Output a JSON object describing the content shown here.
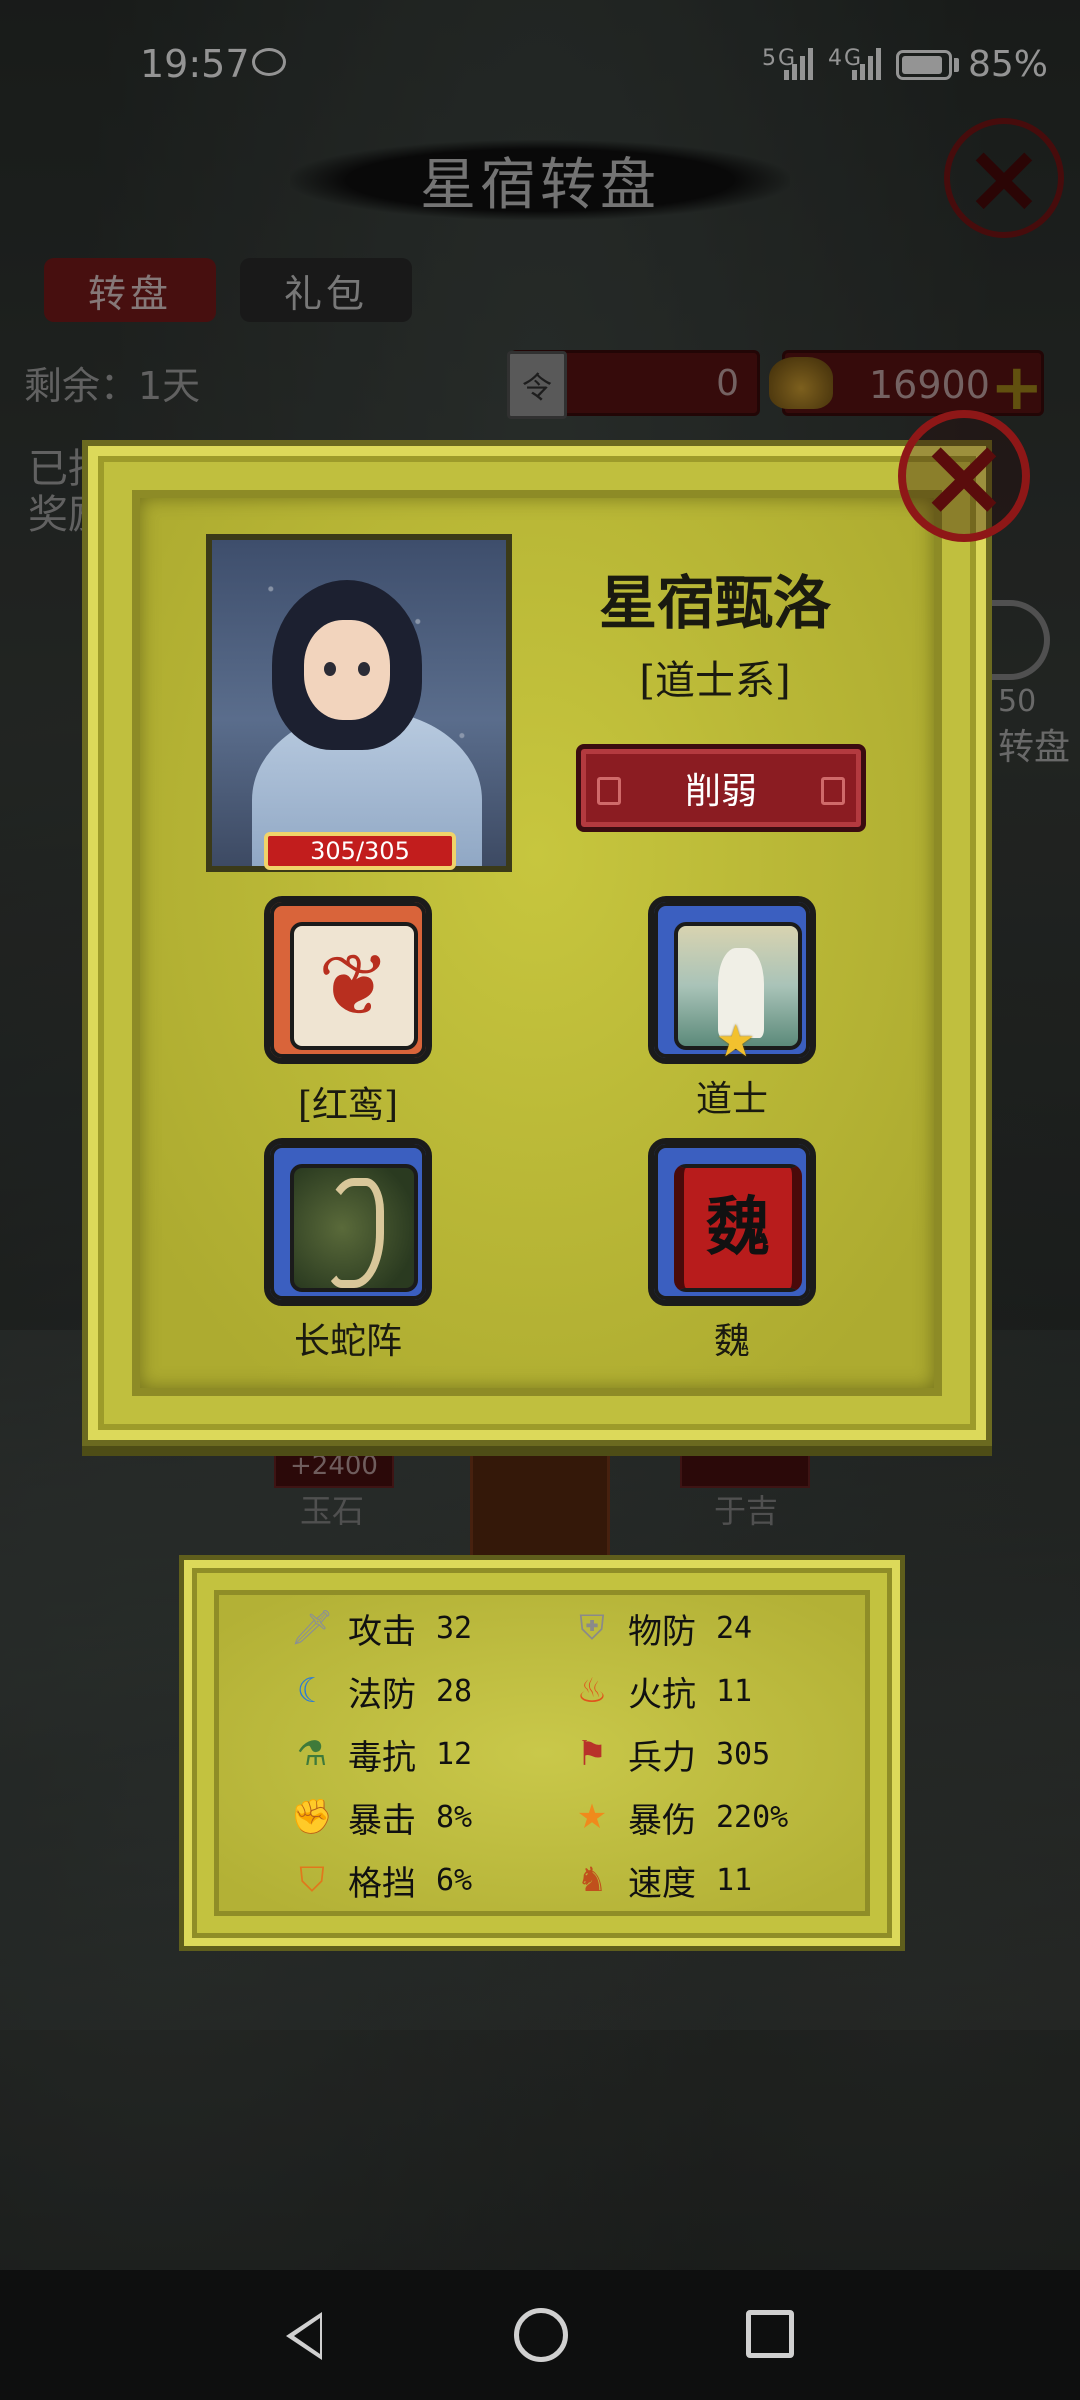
{
  "status_bar": {
    "time": "19:57",
    "network1": "5G",
    "network2": "4G",
    "battery": "85%"
  },
  "background_page": {
    "title": "星宿转盘",
    "tabs": [
      "转盘",
      "礼包"
    ],
    "remaining": "剩余：1天",
    "partial_line1": "已抽",
    "partial_line2": "奖励",
    "token_icon": "令",
    "token_count": "0",
    "gold_count": "16900",
    "gold_plus": "+",
    "side_number": "50",
    "side_label": "转盘",
    "reward_left_value": "+2400",
    "reward_left_name": "玉石",
    "reward_right_name": "于吉"
  },
  "hero": {
    "name": "星宿甄洛",
    "class": "[道士系]",
    "hp": "305/305",
    "hp_fraction": 1.0,
    "weaken_button": "削弱",
    "skills": [
      {
        "label": "[红鸾]",
        "icon": "phoenix-icon"
      },
      {
        "label": "道士",
        "icon": "taoist-icon",
        "star": "★"
      },
      {
        "label": "长蛇阵",
        "icon": "snake-formation-icon"
      },
      {
        "label": "魏",
        "icon": "wei-banner-icon",
        "glyph": "魏"
      }
    ]
  },
  "stats": [
    {
      "name": "攻击",
      "value": "32",
      "icon": "sword-icon"
    },
    {
      "name": "物防",
      "value": "24",
      "icon": "armor-icon"
    },
    {
      "name": "法防",
      "value": "28",
      "icon": "magic-shield-icon"
    },
    {
      "name": "火抗",
      "value": "11",
      "icon": "fire-icon"
    },
    {
      "name": "毒抗",
      "value": "12",
      "icon": "poison-icon"
    },
    {
      "name": "兵力",
      "value": "305",
      "icon": "troops-icon"
    },
    {
      "name": "暴击",
      "value": "8%",
      "icon": "fist-icon"
    },
    {
      "name": "暴伤",
      "value": "220%",
      "icon": "burst-star-icon"
    },
    {
      "name": "格挡",
      "value": "6%",
      "icon": "shield-icon"
    },
    {
      "name": "速度",
      "value": "11",
      "icon": "horse-icon"
    }
  ],
  "colors": {
    "panel_yellow": "#c0bf3e",
    "panel_border": "#dcd95a",
    "button_red": "#8b1c22",
    "hp_red": "#c21d1d"
  }
}
